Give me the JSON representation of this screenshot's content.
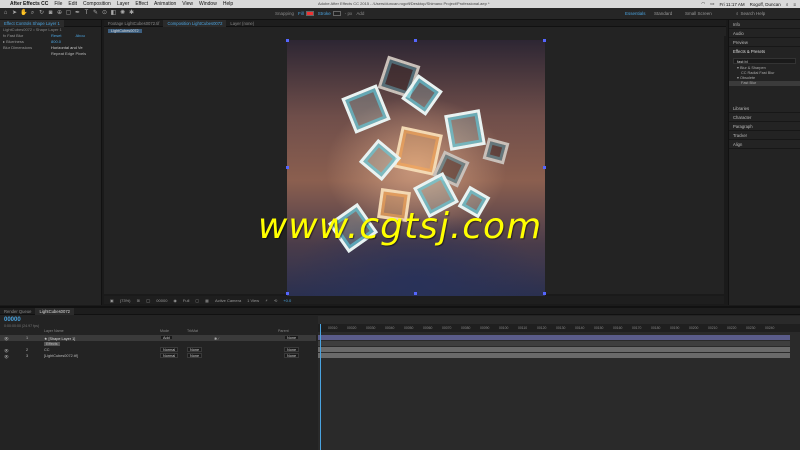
{
  "menubar": {
    "app_name": "After Effects CC",
    "items": [
      "File",
      "Edit",
      "Composition",
      "Layer",
      "Effect",
      "Animation",
      "View",
      "Window",
      "Help"
    ],
    "window_title": "Adobe After Effects CC 2015 - /Users/duncan.rogoff/Desktop/Shimano Project/Professional.aep *",
    "clock": "Fri 11:17 AM",
    "user": "Rogoff, Duncan"
  },
  "toolbar": {
    "snapping_label": "Snapping",
    "fill_label": "Fill",
    "stroke_label": "Stroke",
    "stroke_px": "- px",
    "add_label": "Add",
    "workspaces": [
      "Essentials",
      "Standard",
      "Small Screen"
    ],
    "search_label": "Search Help"
  },
  "effect_controls": {
    "tab_label": "Effect Controls Shape Layer 1",
    "header": "LightCubes0072 • Shape Layer 1",
    "rows": [
      {
        "key": "fx  Fast Blur",
        "value": "Reset",
        "extra": "Abou"
      },
      {
        "key": "  ▸ Blurriness",
        "value": "800.0"
      },
      {
        "key": "  Blur Dimensions",
        "value": "Horizontal and Ve"
      },
      {
        "key": "",
        "value": "Repeat Edge Pixels"
      }
    ]
  },
  "viewer": {
    "tabs": [
      "Footage LightCubes0072.tif",
      "Composition LightCubes0072",
      "Layer (none)"
    ],
    "sub_tab": "LightCubes0072",
    "zoom": "(73%)",
    "timecode": "00000",
    "resolution": "Full",
    "camera": "Active Camera",
    "views": "1 View",
    "exposure": "+0.0"
  },
  "right_panel": {
    "info": "Info",
    "audio": "Audio",
    "preview": "Preview",
    "effects_presets": "Effects & Presets",
    "search_value": "fast bl",
    "category_blur": "▾ Blur & Sharpen",
    "effect_radial": "CC Radial Fast Blur",
    "category_obsolete": "▾ Obsolete",
    "effect_fast_blur": "Fast Blur",
    "libraries": "Libraries",
    "character": "Character",
    "paragraph": "Paragraph",
    "tracker": "Tracker",
    "align": "Align"
  },
  "timeline": {
    "tabs": [
      "Render Queue",
      "LightCubes0072"
    ],
    "timecode": "00000",
    "fps": "0:00:00:00 (24.97 fps)",
    "col_layer_name": "Layer Name",
    "col_mode": "Mode",
    "col_trkmat": "TrkMat",
    "col_parent": "Parent",
    "layers": [
      {
        "num": "1",
        "name": "★ [Shape Layer 1]",
        "mode": "Add",
        "trkmat": "",
        "parent": "None"
      },
      {
        "num": "",
        "name": "Effects",
        "mode": "",
        "trkmat": "",
        "parent": ""
      },
      {
        "num": "2",
        "name": "CC",
        "mode": "Normal",
        "trkmat": "None",
        "parent": "None"
      },
      {
        "num": "3",
        "name": "[LightCubes0072.tif]",
        "mode": "Normal",
        "trkmat": "None",
        "parent": "None"
      }
    ],
    "ruler_ticks": [
      "00010",
      "00020",
      "00030",
      "00040",
      "00050",
      "00060",
      "00070",
      "00080",
      "00090",
      "00100",
      "00110",
      "00120",
      "00130",
      "00140",
      "00150",
      "00160",
      "00170",
      "00180",
      "00190",
      "00200",
      "00210",
      "00220",
      "00230",
      "00240"
    ]
  },
  "watermark": "www.cgtsj.com"
}
